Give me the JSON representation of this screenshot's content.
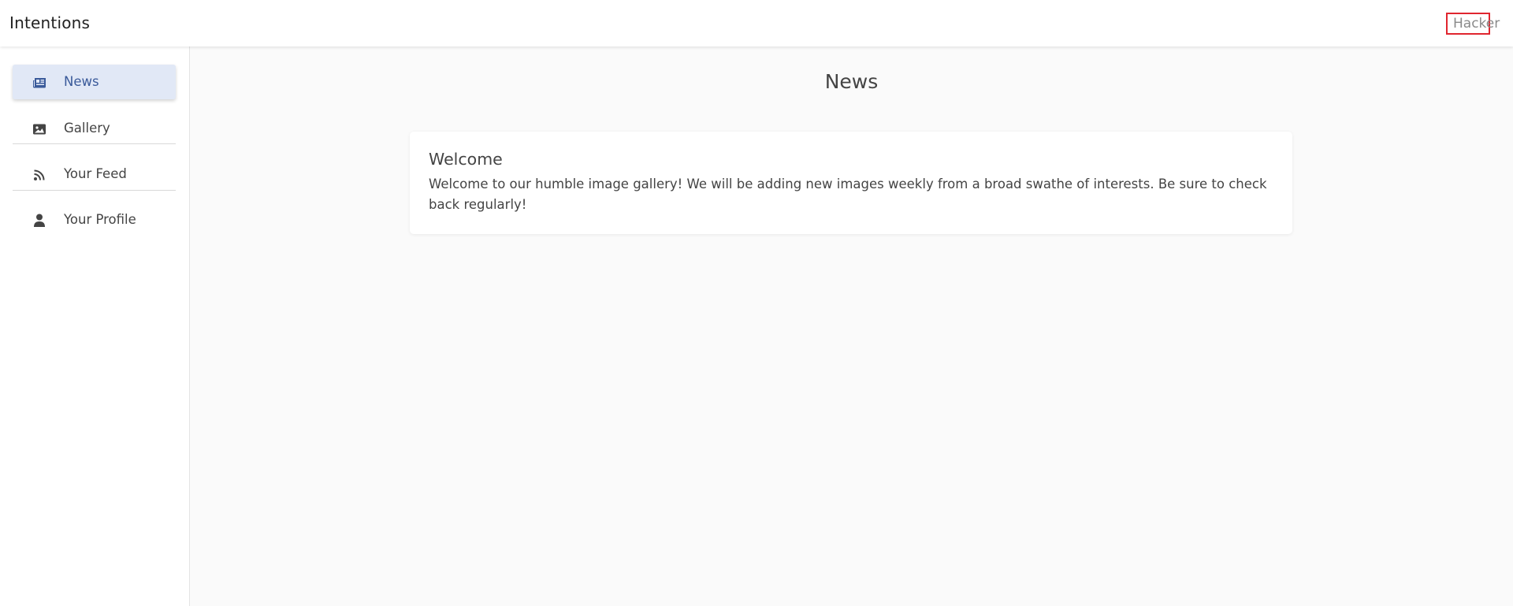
{
  "header": {
    "app_title": "Intentions",
    "user_label": "Hacker"
  },
  "sidebar": {
    "items": [
      {
        "label": "News",
        "icon": "newspaper-icon",
        "active": true
      },
      {
        "label": "Gallery",
        "icon": "image-icon",
        "active": false
      },
      {
        "label": "Your Feed",
        "icon": "rss-icon",
        "active": false
      },
      {
        "label": "Your Profile",
        "icon": "user-icon",
        "active": false
      }
    ]
  },
  "main": {
    "page_title": "News",
    "card": {
      "title": "Welcome",
      "body": "Welcome to our humble image gallery! We will be adding new images weekly from a broad swathe of interests. Be sure to check back regularly!"
    }
  },
  "colors": {
    "active_bg": "#e1e8f6",
    "active_text": "#3a5a9a",
    "user_box_border": "#e0252f"
  }
}
